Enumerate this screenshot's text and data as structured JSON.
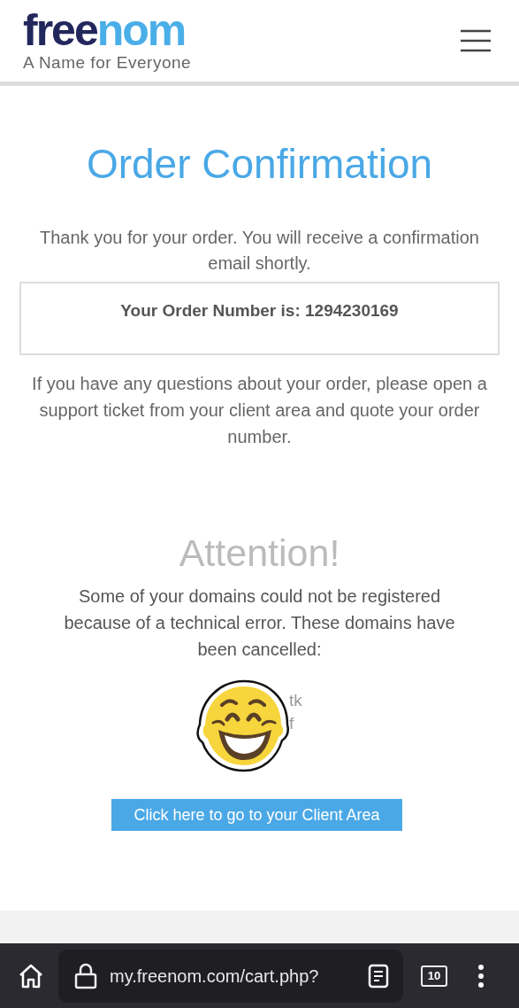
{
  "header": {
    "logo": {
      "text_dark": "free",
      "text_light": "nom"
    },
    "tagline": "A Name for Everyone"
  },
  "title": "Order Confirmation",
  "thanks": "Thank you for your order. You will receive a confirmation email shortly.",
  "order_box": {
    "text": "Your Order Number is: 1294230169"
  },
  "questions": "If you have any questions about your order, please open a support ticket from your client area and quote your order number.",
  "attention": {
    "title": "Attention!",
    "message": "Some of your domains could not be registered because of a technical error. These domains have been cancelled:",
    "domain_fragments": [
      "tk",
      "f"
    ]
  },
  "client_area_button": "Click here to go to your Client Area",
  "browser_bar": {
    "url": "my.freenom.com/cart.php?",
    "tab_count": "10"
  }
}
